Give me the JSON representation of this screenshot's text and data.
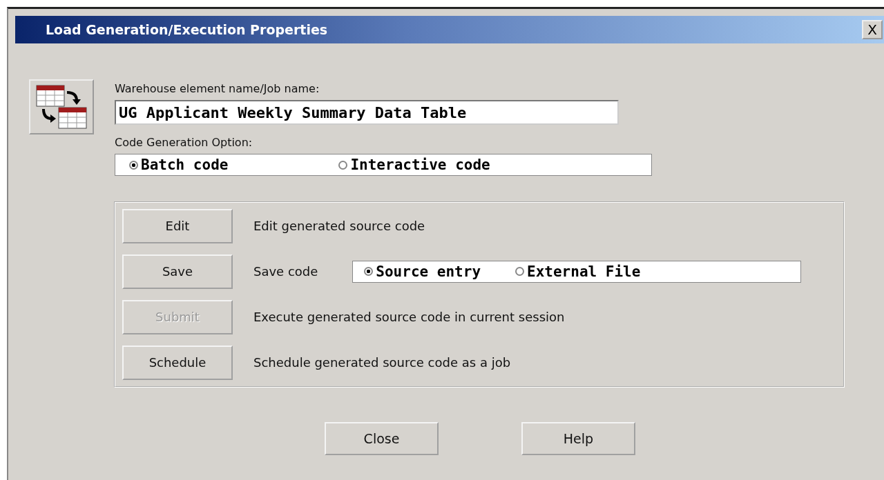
{
  "window": {
    "title": "Load Generation/Execution Properties",
    "close_label": "X"
  },
  "job_name": {
    "label": "Warehouse element name/Job name:",
    "value": "UG Applicant Weekly Summary Data Table"
  },
  "code_generation": {
    "label": "Code Generation Option:",
    "options": [
      {
        "label": "Batch code",
        "selected": true
      },
      {
        "label": "Interactive code",
        "selected": false
      }
    ]
  },
  "actions": [
    {
      "button": "Edit",
      "disabled": false,
      "description": "Edit generated source code"
    },
    {
      "button": "Save",
      "disabled": false,
      "description": "Save code",
      "options": [
        {
          "label": "Source entry",
          "selected": true
        },
        {
          "label": "External File",
          "selected": false
        }
      ]
    },
    {
      "button": "Submit",
      "disabled": true,
      "description": "Execute generated source code in current session"
    },
    {
      "button": "Schedule",
      "disabled": false,
      "description": "Schedule generated source code as a job"
    }
  ],
  "buttons": [
    "Close",
    "Help"
  ]
}
